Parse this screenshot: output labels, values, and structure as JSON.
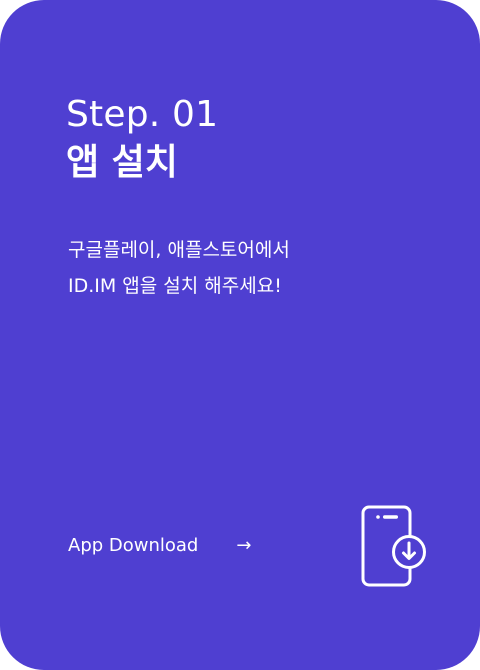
{
  "card": {
    "step_label": "Step. 01",
    "title": "앱 설치",
    "description_lines": [
      "구글플레이, 애플스토어에서",
      "ID.IM 앱을  설치 해주세요!"
    ],
    "download_label": "App Download",
    "arrow_glyph": "→",
    "icon": "phone-download-icon"
  },
  "colors": {
    "background": "#4F3FD1",
    "text": "#FFFFFF"
  }
}
